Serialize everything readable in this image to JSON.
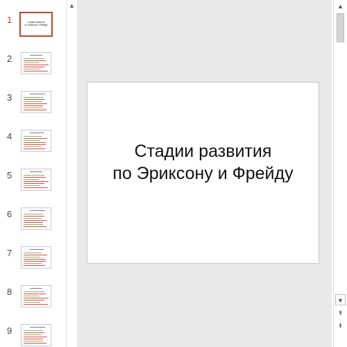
{
  "thumbnails": [
    {
      "number": "1",
      "title_line1": "Стадии развития",
      "title_line2": "по Эриксону и Фрейду",
      "active": true
    },
    {
      "number": "2"
    },
    {
      "number": "3"
    },
    {
      "number": "4"
    },
    {
      "number": "5"
    },
    {
      "number": "6"
    },
    {
      "number": "7"
    },
    {
      "number": "8"
    },
    {
      "number": "9"
    }
  ],
  "slide": {
    "title_line1": "Стадии развития",
    "title_line2": "по Эриксону и Фрейду"
  },
  "icons": {
    "scroll_up": "▲",
    "scroll_down": "▼",
    "prev_slide": "⇞",
    "next_slide": "⇟"
  },
  "colors": {
    "accent": "#c0452a",
    "workspace": "#e9e9e9",
    "thumb_title_line": "#8b6ab0",
    "thumb_green_text": "#7fb85a",
    "thumb_red_text": "#e04646"
  }
}
